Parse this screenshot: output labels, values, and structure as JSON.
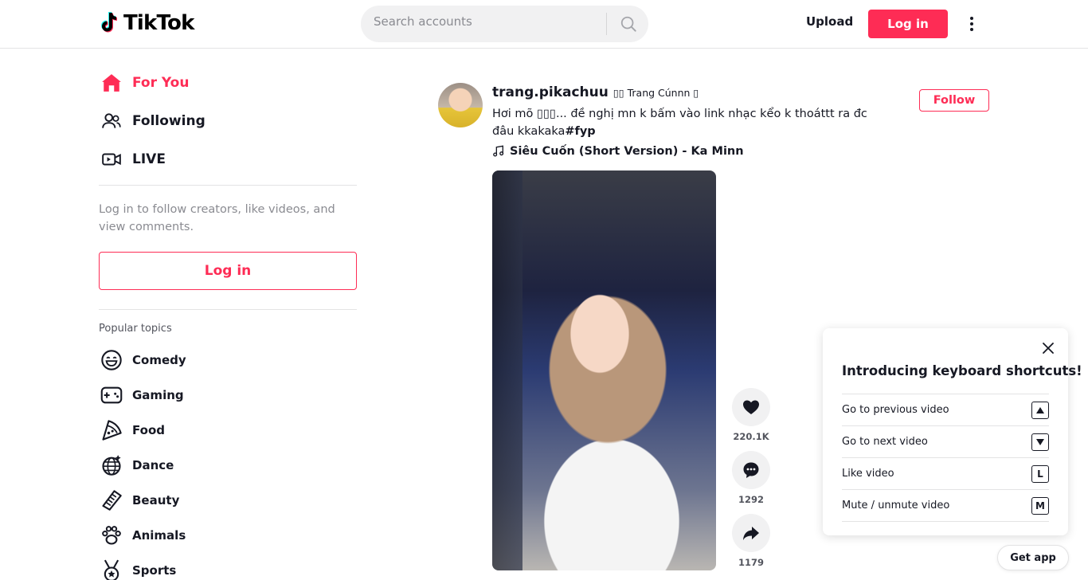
{
  "header": {
    "logo_text": "TikTok",
    "search_placeholder": "Search accounts",
    "upload_label": "Upload",
    "login_label": "Log in"
  },
  "sidebar": {
    "nav": [
      {
        "label": "For You",
        "icon": "home-icon",
        "active": true
      },
      {
        "label": "Following",
        "icon": "people-icon"
      },
      {
        "label": "LIVE",
        "icon": "live-icon"
      }
    ],
    "login_prompt": "Log in to follow creators, like videos, and view comments.",
    "login_button": "Log in",
    "topics_title": "Popular topics",
    "topics": [
      {
        "label": "Comedy",
        "icon": "smile-icon"
      },
      {
        "label": "Gaming",
        "icon": "gamepad-icon"
      },
      {
        "label": "Food",
        "icon": "pizza-icon"
      },
      {
        "label": "Dance",
        "icon": "disco-ball-icon"
      },
      {
        "label": "Beauty",
        "icon": "comb-icon"
      },
      {
        "label": "Animals",
        "icon": "paw-icon"
      },
      {
        "label": "Sports",
        "icon": "medal-icon"
      }
    ]
  },
  "post": {
    "username": "trang.pikachuu",
    "nickname": "▯▯ Trang Cúnnn ▯",
    "caption": "Hơi mõ ▯▯▯... đề nghị mn k bấm vào link nhạc kểo k thoáttt ra đc đâu kkakaka",
    "hashtag": "#fyp",
    "music": "Siêu Cuốn (Short Version) - Ka Minn",
    "follow_label": "Follow",
    "likes": "220.1K",
    "comments": "1292",
    "shares": "1179"
  },
  "shortcuts": {
    "title": "Introducing keyboard shortcuts!",
    "items": [
      {
        "label": "Go to previous video",
        "key": "up-arrow-key"
      },
      {
        "label": "Go to next video",
        "key": "down-arrow-key"
      },
      {
        "label": "Like video",
        "key": "L"
      },
      {
        "label": "Mute / unmute video",
        "key": "M"
      }
    ]
  },
  "get_app_label": "Get app",
  "colors": {
    "brand": "#fe2c55",
    "text": "#161823",
    "muted": "#8a8b91"
  }
}
